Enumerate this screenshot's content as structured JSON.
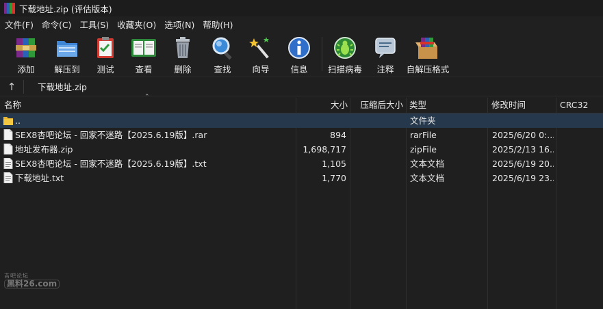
{
  "window": {
    "title": "下载地址.zip (评估版本)"
  },
  "menu": [
    "文件(F)",
    "命令(C)",
    "工具(S)",
    "收藏夹(O)",
    "选项(N)",
    "帮助(H)"
  ],
  "toolbar": [
    {
      "label": "添加",
      "icon": "add-archive-icon"
    },
    {
      "label": "解压到",
      "icon": "extract-to-icon"
    },
    {
      "label": "测试",
      "icon": "test-icon"
    },
    {
      "label": "查看",
      "icon": "view-icon"
    },
    {
      "label": "删除",
      "icon": "delete-icon"
    },
    {
      "label": "查找",
      "icon": "find-icon"
    },
    {
      "label": "向导",
      "icon": "wizard-icon"
    },
    {
      "label": "信息",
      "icon": "info-icon"
    },
    {
      "label": "扫描病毒",
      "icon": "virus-scan-icon"
    },
    {
      "label": "注释",
      "icon": "comment-icon"
    },
    {
      "label": "自解压格式",
      "icon": "sfx-icon"
    }
  ],
  "address": {
    "path": "下载地址.zip"
  },
  "columns": [
    "名称",
    "大小",
    "压缩后大小",
    "类型",
    "修改时间",
    "CRC32"
  ],
  "rows": [
    {
      "name": "..",
      "size": "",
      "packed": "",
      "type": "文件夹",
      "modified": "",
      "crc": "",
      "icon": "folder-icon"
    },
    {
      "name": "SEX8杏吧论坛 - 回家不迷路【2025.6.19版】.rar",
      "size": "894",
      "packed": "",
      "type": "rarFile",
      "modified": "2025/6/20 0:...",
      "crc": "",
      "icon": "file-icon"
    },
    {
      "name": "地址发布器.zip",
      "size": "1,698,717",
      "packed": "",
      "type": "zipFile",
      "modified": "2025/2/13 16...",
      "crc": "",
      "icon": "file-icon"
    },
    {
      "name": "SEX8杏吧论坛 - 回家不迷路【2025.6.19版】.txt",
      "size": "1,105",
      "packed": "",
      "type": "文本文档",
      "modified": "2025/6/19 20...",
      "crc": "",
      "icon": "text-file-icon"
    },
    {
      "name": "下载地址.txt",
      "size": "1,770",
      "packed": "",
      "type": "文本文档",
      "modified": "2025/6/19 23...",
      "crc": "",
      "icon": "text-file-icon"
    }
  ],
  "watermark": {
    "top": "吉吧论坛",
    "bottom": "黑料26.com"
  }
}
